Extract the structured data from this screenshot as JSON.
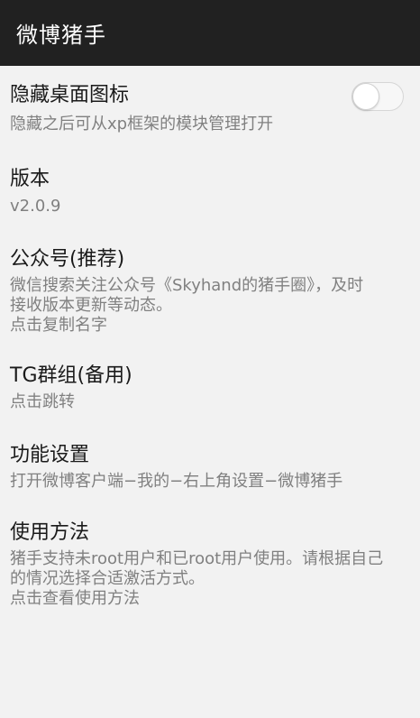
{
  "app_bar": {
    "title": "微博猪手"
  },
  "prefs": [
    {
      "title": "隐藏桌面图标",
      "summary": "隐藏之后可从xp框架的模块管理打开",
      "switch_on": false
    },
    {
      "title": "版本",
      "summary": "v2.0.9"
    },
    {
      "title": "公众号(推荐)",
      "summary": "微信搜索关注公众号《Skyhand的猪手圈》，及时\n接收版本更新等动态。\n点击复制名字"
    },
    {
      "title": "TG群组(备用)",
      "summary": "点击跳转"
    },
    {
      "title": "功能设置",
      "summary": "打开微博客户端−我的−右上角设置−微博猪手"
    },
    {
      "title": "使用方法",
      "summary": "猪手支持未root用户和已root用户使用。请根据自己\n的情况选择合适激活方式。\n点击查看使用方法"
    }
  ],
  "colors": {
    "app_bar_bg": "#212121",
    "page_bg": "#f2f2f2",
    "title_text": "#1a1a1a",
    "summary_text": "#808080"
  }
}
